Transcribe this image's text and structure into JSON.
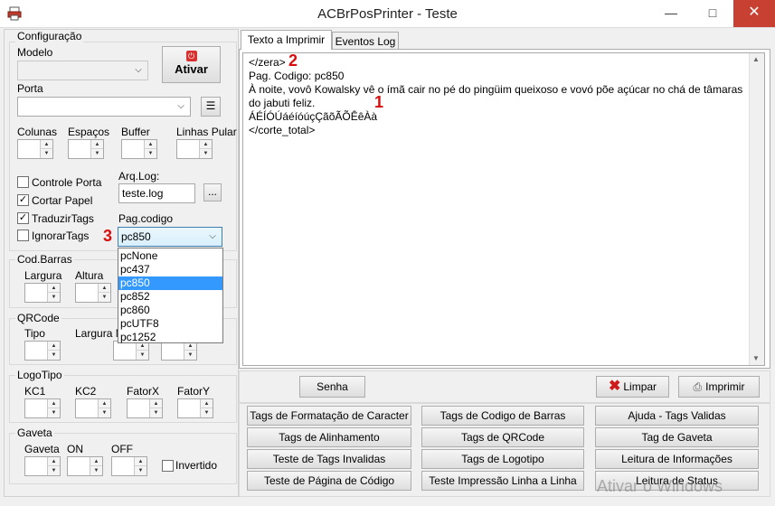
{
  "window": {
    "title": "ACBrPosPrinter - Teste"
  },
  "config": {
    "group_label": "Configuração",
    "modelo_label": "Modelo",
    "ativar_label": "Ativar",
    "porta_label": "Porta",
    "colunas_label": "Colunas",
    "espacos_label": "Espaços",
    "buffer_label": "Buffer",
    "linhas_pular_label": "Linhas Pular",
    "controle_porta_label": "Controle Porta",
    "cortar_papel_label": "Cortar Papel",
    "traduzir_tags_label": "TraduzirTags",
    "ignorar_tags_label": "IgnorarTags",
    "controle_porta_checked": false,
    "cortar_papel_checked": true,
    "traduzir_tags_checked": true,
    "ignorar_tags_checked": false,
    "arq_log_label": "Arq.Log:",
    "arq_log_value": "teste.log",
    "browse_label": "...",
    "pag_codigo_label": "Pag.codigo",
    "pag_codigo_value": "pc850",
    "pag_codigo_options": [
      "pcNone",
      "pc437",
      "pc850",
      "pc852",
      "pc860",
      "pcUTF8",
      "pc1252"
    ],
    "pag_codigo_selected_index": 2
  },
  "codbarras": {
    "group_label": "Cod.Barras",
    "largura_label": "Largura",
    "altura_label": "Altura"
  },
  "qrcode": {
    "group_label": "QRCode",
    "tipo_label": "Tipo",
    "largura_label": "Largura M"
  },
  "logotipo": {
    "group_label": "LogoTipo",
    "kc1_label": "KC1",
    "kc2_label": "KC2",
    "fatorx_label": "FatorX",
    "fatory_label": "FatorY"
  },
  "gaveta": {
    "group_label": "Gaveta",
    "gaveta_label": "Gaveta",
    "on_label": "ON",
    "off_label": "OFF",
    "invertido_label": "Invertido",
    "invertido_checked": false
  },
  "tabs": [
    {
      "label": "Texto a Imprimir"
    },
    {
      "label": "Eventos Log"
    }
  ],
  "editor": {
    "lines": [
      "</zera>",
      "Pag. Codigo: pc850",
      "À noite, vovô Kowalsky vê o ímã cair no pé do pingüim queixoso e vovó põe açúcar no chá de tâmaras",
      "do jabuti feliz.",
      "ÁÉÍÓÚáéíóúçÇãõÃÕÊêÀà",
      "</corte_total>"
    ]
  },
  "annotations": {
    "one": "1",
    "two": "2",
    "three": "3",
    "color": "#d80d0d"
  },
  "actions": {
    "senha": "Senha",
    "limpar": "Limpar",
    "imprimir": "Imprimir"
  },
  "buttons": {
    "tags_formatacao": "Tags de Formatação de Caracter",
    "tags_codigo_barras": "Tags de Codigo de Barras",
    "ajuda_tags": "Ajuda - Tags Validas",
    "tags_alinhamento": "Tags de Alinhamento",
    "tags_qrcode": "Tags de QRCode",
    "tag_gaveta": "Tag de Gaveta",
    "teste_tags_invalidas": "Teste de Tags Invalidas",
    "tags_logotipo": "Tags de Logotipo",
    "leitura_informacoes": "Leitura de Informações",
    "teste_pagina_codigo": "Teste de Página de Código",
    "teste_impressao_linha": "Teste Impressão Linha a Linha",
    "leitura_status": "Leitura de Status"
  },
  "watermark": {
    "text": "Ativar o Windows"
  }
}
